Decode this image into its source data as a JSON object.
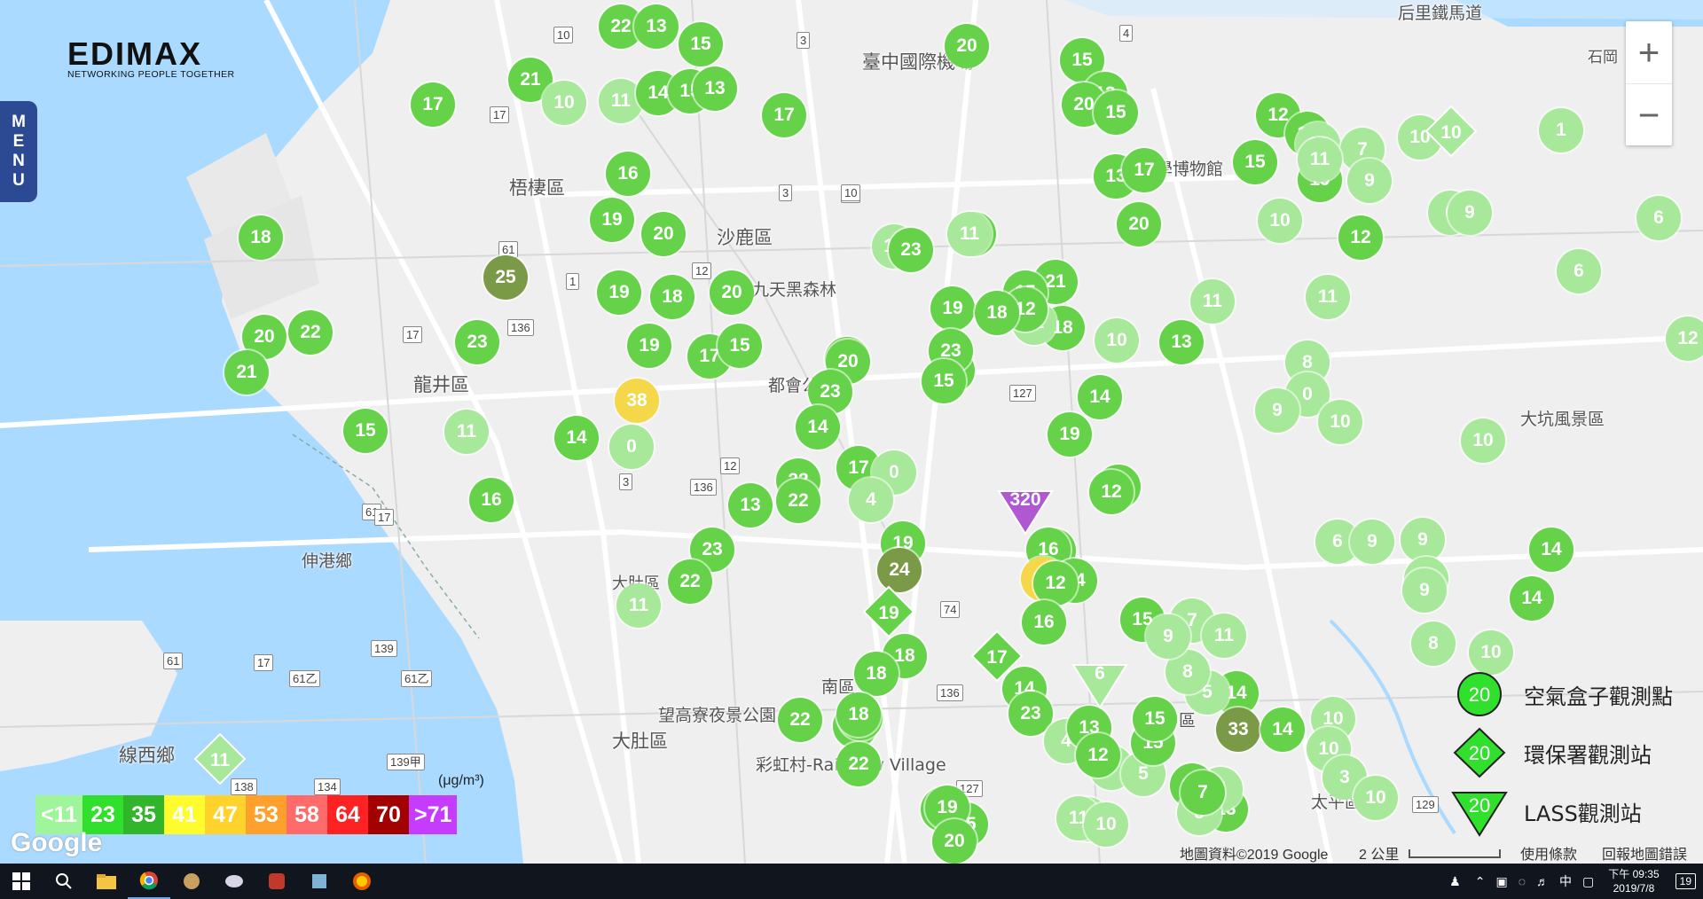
{
  "brand": {
    "name": "EDIMAX",
    "tagline": "NETWORKING PEOPLE TOGETHER"
  },
  "menu": {
    "label": "MENU"
  },
  "zoom": {
    "in": "+",
    "out": "−"
  },
  "places": [
    {
      "name": "梧棲區"
    },
    {
      "name": "沙鹿區"
    },
    {
      "name": "龍井區"
    },
    {
      "name": "大肚區"
    },
    {
      "name": "大肚區"
    },
    {
      "name": "線西鄉"
    },
    {
      "name": "臺中國際機場"
    },
    {
      "name": "九天黑森林"
    },
    {
      "name": "都會公園"
    },
    {
      "name": "望高寮夜景公園"
    },
    {
      "name": "彩虹村-Rainbow Village"
    },
    {
      "name": "大坑風景區"
    },
    {
      "name": "台中科學博物館"
    },
    {
      "name": "中區"
    },
    {
      "name": "南區"
    },
    {
      "name": "太平區"
    },
    {
      "name": "伸港鄉"
    },
    {
      "name": "后里鐵馬道"
    },
    {
      "name": "石岡"
    }
  ],
  "roads": [
    "10",
    "3",
    "10",
    "17",
    "61",
    "12",
    "136",
    "1",
    "17",
    "61",
    "3",
    "12",
    "136",
    "17",
    "139",
    "61",
    "17",
    "61乙",
    "61乙",
    "139甲",
    "134",
    "138",
    "127",
    "74",
    "1",
    "136",
    "127",
    "129",
    "4",
    "10",
    "3"
  ],
  "markers": [
    {
      "v": "22",
      "c": "green"
    },
    {
      "v": "13",
      "c": "green"
    },
    {
      "v": "15",
      "c": "green"
    },
    {
      "v": "21",
      "c": "green"
    },
    {
      "v": "10",
      "c": "light"
    },
    {
      "v": "11",
      "c": "light"
    },
    {
      "v": "14",
      "c": "green"
    },
    {
      "v": "15",
      "c": "green"
    },
    {
      "v": "17",
      "c": "green"
    },
    {
      "v": "13",
      "c": "green"
    },
    {
      "v": "20",
      "c": "green"
    },
    {
      "v": "15",
      "c": "green"
    },
    {
      "v": "13",
      "c": "green"
    },
    {
      "v": "17",
      "c": "green"
    },
    {
      "v": "18",
      "c": "green"
    },
    {
      "v": "16",
      "c": "green"
    },
    {
      "v": "19",
      "c": "green"
    },
    {
      "v": "20",
      "c": "green"
    },
    {
      "v": "25",
      "c": "olive"
    },
    {
      "v": "20",
      "c": "green"
    },
    {
      "v": "22",
      "c": "green"
    },
    {
      "v": "21",
      "c": "green"
    },
    {
      "v": "23",
      "c": "green"
    },
    {
      "v": "19",
      "c": "green"
    },
    {
      "v": "18",
      "c": "green"
    },
    {
      "v": "20",
      "c": "green"
    },
    {
      "v": "19",
      "c": "green"
    },
    {
      "v": "17",
      "c": "green"
    },
    {
      "v": "15",
      "c": "green"
    },
    {
      "v": "38",
      "c": "yellow"
    },
    {
      "v": "15",
      "c": "green"
    },
    {
      "v": "11",
      "c": "light"
    },
    {
      "v": "14",
      "c": "green"
    },
    {
      "v": "0",
      "c": "light"
    },
    {
      "v": "16",
      "c": "green"
    },
    {
      "v": "10",
      "c": "light"
    },
    {
      "v": "23",
      "c": "green"
    },
    {
      "v": "19",
      "c": "green"
    },
    {
      "v": "11",
      "c": "light"
    },
    {
      "v": "22",
      "c": "green"
    },
    {
      "v": "18",
      "c": "green"
    },
    {
      "v": "18",
      "c": "green"
    },
    {
      "v": "11",
      "c": "light"
    },
    {
      "v": "6",
      "c": "light"
    },
    {
      "v": "21",
      "c": "green"
    },
    {
      "v": "20",
      "c": "green"
    },
    {
      "v": "23",
      "c": "green"
    },
    {
      "v": "14",
      "c": "green"
    },
    {
      "v": "22",
      "c": "green"
    },
    {
      "v": "13",
      "c": "green"
    },
    {
      "v": "22",
      "c": "green"
    },
    {
      "v": "17",
      "c": "green"
    },
    {
      "v": "0",
      "c": "light"
    },
    {
      "v": "4",
      "c": "light"
    },
    {
      "v": "19",
      "c": "green"
    },
    {
      "v": "24",
      "c": "olive"
    },
    {
      "v": "18",
      "c": "green"
    },
    {
      "v": "18",
      "c": "green"
    },
    {
      "v": "22",
      "c": "green"
    },
    {
      "v": "23",
      "c": "green"
    },
    {
      "v": "22",
      "c": "green"
    },
    {
      "v": "11",
      "c": "light"
    },
    {
      "v": "19",
      "c": "green"
    },
    {
      "v": "23",
      "c": "green"
    },
    {
      "v": "15",
      "c": "green"
    },
    {
      "v": "12",
      "c": "green"
    },
    {
      "v": "18",
      "c": "green"
    },
    {
      "v": "15",
      "c": "green"
    },
    {
      "v": "10",
      "c": "light"
    },
    {
      "v": "13",
      "c": "green"
    },
    {
      "v": "14",
      "c": "green"
    },
    {
      "v": "19",
      "c": "green"
    },
    {
      "v": "13",
      "c": "green"
    },
    {
      "v": "20",
      "c": "green"
    },
    {
      "v": "15",
      "c": "green"
    },
    {
      "v": "13",
      "c": "green"
    },
    {
      "v": "20",
      "c": "green"
    },
    {
      "v": "17",
      "c": "green"
    },
    {
      "v": "11",
      "c": "light"
    },
    {
      "v": "12",
      "c": "green"
    },
    {
      "v": "12",
      "c": "green"
    },
    {
      "v": "16",
      "c": "green"
    },
    {
      "v": "17",
      "c": "yellow"
    },
    {
      "v": "14",
      "c": "green"
    },
    {
      "v": "12",
      "c": "green"
    },
    {
      "v": "12",
      "c": "green"
    },
    {
      "v": "12",
      "c": "green"
    },
    {
      "v": "15",
      "c": "green"
    },
    {
      "v": "10",
      "c": "light"
    },
    {
      "v": "7",
      "c": "light"
    },
    {
      "v": "19",
      "c": "green"
    },
    {
      "v": "9",
      "c": "light"
    },
    {
      "v": "11",
      "c": "light"
    },
    {
      "v": "10",
      "c": "light"
    },
    {
      "v": "12",
      "c": "green"
    },
    {
      "v": "6",
      "c": "light"
    },
    {
      "v": "9",
      "c": "light"
    },
    {
      "v": "10",
      "c": "light"
    },
    {
      "v": "1",
      "c": "light"
    },
    {
      "v": "6",
      "c": "light"
    },
    {
      "v": "11",
      "c": "light"
    },
    {
      "v": "8",
      "c": "light"
    },
    {
      "v": "0",
      "c": "light"
    },
    {
      "v": "9",
      "c": "light"
    },
    {
      "v": "10",
      "c": "light"
    },
    {
      "v": "10",
      "c": "light"
    },
    {
      "v": "6",
      "c": "light"
    },
    {
      "v": "9",
      "c": "light"
    },
    {
      "v": "14",
      "c": "green"
    },
    {
      "v": "9",
      "c": "light"
    },
    {
      "v": "5",
      "c": "light"
    },
    {
      "v": "14",
      "c": "green"
    },
    {
      "v": "9",
      "c": "light"
    },
    {
      "v": "10",
      "c": "light"
    },
    {
      "v": "8",
      "c": "light"
    },
    {
      "v": "14",
      "c": "green"
    },
    {
      "v": "33",
      "c": "olive"
    },
    {
      "v": "14",
      "c": "green"
    },
    {
      "v": "10",
      "c": "light"
    },
    {
      "v": "13",
      "c": "green"
    },
    {
      "v": "7",
      "c": "light"
    },
    {
      "v": "12",
      "c": "green"
    },
    {
      "v": "8",
      "c": "light"
    },
    {
      "v": "10",
      "c": "light"
    },
    {
      "v": "3",
      "c": "light"
    },
    {
      "v": "10",
      "c": "light"
    },
    {
      "v": "16",
      "c": "green"
    },
    {
      "v": "14",
      "c": "green"
    },
    {
      "v": "23",
      "c": "green"
    },
    {
      "v": "4",
      "c": "light"
    },
    {
      "v": "9",
      "c": "light"
    },
    {
      "v": "5",
      "c": "light"
    },
    {
      "v": "15",
      "c": "green"
    },
    {
      "v": "7",
      "c": "green"
    },
    {
      "v": "11",
      "c": "light"
    },
    {
      "v": "13",
      "c": "green"
    },
    {
      "v": "15",
      "c": "green"
    },
    {
      "v": "19",
      "c": "green"
    },
    {
      "v": "20",
      "c": "green"
    },
    {
      "v": "18",
      "c": "green"
    },
    {
      "v": "18",
      "c": "green"
    },
    {
      "v": "22",
      "c": "green"
    },
    {
      "v": "18",
      "c": "green"
    },
    {
      "v": "15",
      "c": "green"
    },
    {
      "v": "13",
      "c": "green"
    },
    {
      "v": "12",
      "c": "green"
    },
    {
      "v": "15",
      "c": "green"
    },
    {
      "v": "7",
      "c": "light"
    },
    {
      "v": "11",
      "c": "light"
    },
    {
      "v": "5",
      "c": "light"
    },
    {
      "v": "11",
      "c": "light"
    },
    {
      "v": "10",
      "c": "light"
    },
    {
      "v": "8",
      "c": "light"
    },
    {
      "v": "9",
      "c": "light"
    },
    {
      "v": "12",
      "c": "light"
    }
  ],
  "special_markers": [
    {
      "v": "320",
      "shape": "triangle",
      "c": "purple"
    },
    {
      "v": "17",
      "shape": "diamond",
      "c": "green"
    },
    {
      "v": "19",
      "shape": "diamond",
      "c": "green"
    },
    {
      "v": "10",
      "shape": "diamond",
      "c": "light"
    },
    {
      "v": "11",
      "shape": "diamond",
      "c": "light"
    },
    {
      "v": "6",
      "shape": "triangle",
      "c": "light"
    }
  ],
  "scale": {
    "unit": "(μg/m³)",
    "cells": [
      {
        "label": "<11",
        "color": "#9ff59a",
        "text": "#ffffff"
      },
      {
        "label": "23",
        "color": "#31e02c",
        "text": "#ffffff"
      },
      {
        "label": "35",
        "color": "#31b52a",
        "text": "#ffffff"
      },
      {
        "label": "41",
        "color": "#fffb2c",
        "text": "#ffffff"
      },
      {
        "label": "47",
        "color": "#ffd22c",
        "text": "#ffffff"
      },
      {
        "label": "53",
        "color": "#ffa02c",
        "text": "#ffffff"
      },
      {
        "label": "58",
        "color": "#ff6b6b",
        "text": "#ffffff"
      },
      {
        "label": "64",
        "color": "#ff2222",
        "text": "#ffffff"
      },
      {
        "label": "70",
        "color": "#a30000",
        "text": "#ffffff"
      },
      {
        "label": ">71",
        "color": "#c63cff",
        "text": "#ffffff"
      }
    ]
  },
  "legend": [
    {
      "value": "20",
      "label": "空氣盒子觀測點",
      "shape": "circle"
    },
    {
      "value": "20",
      "label": "環保署觀測站",
      "shape": "diamond"
    },
    {
      "value": "20",
      "label": "LASS觀測站",
      "shape": "triangle"
    }
  ],
  "attribution": {
    "data": "地圖資料©2019 Google",
    "scale": "2 公里",
    "terms": "使用條款",
    "report": "回報地圖錯誤",
    "google": "Google"
  },
  "colors": {
    "green": "#66d24a",
    "light": "#a8e89a",
    "olive": "#7a9a48",
    "yellow": "#f4d84a",
    "purple": "#b057d2",
    "water": "#aadaff",
    "menu": "#2c4a93"
  },
  "taskbar": {
    "time": "下午 09:35",
    "date": "2019/7/8",
    "lang": "中",
    "notifications": "19",
    "icons": [
      "windows-icon",
      "search-icon",
      "file-explorer-icon",
      "chrome-icon",
      "app-icon",
      "app-icon",
      "app-icon",
      "app-icon",
      "firefox-icon"
    ]
  }
}
